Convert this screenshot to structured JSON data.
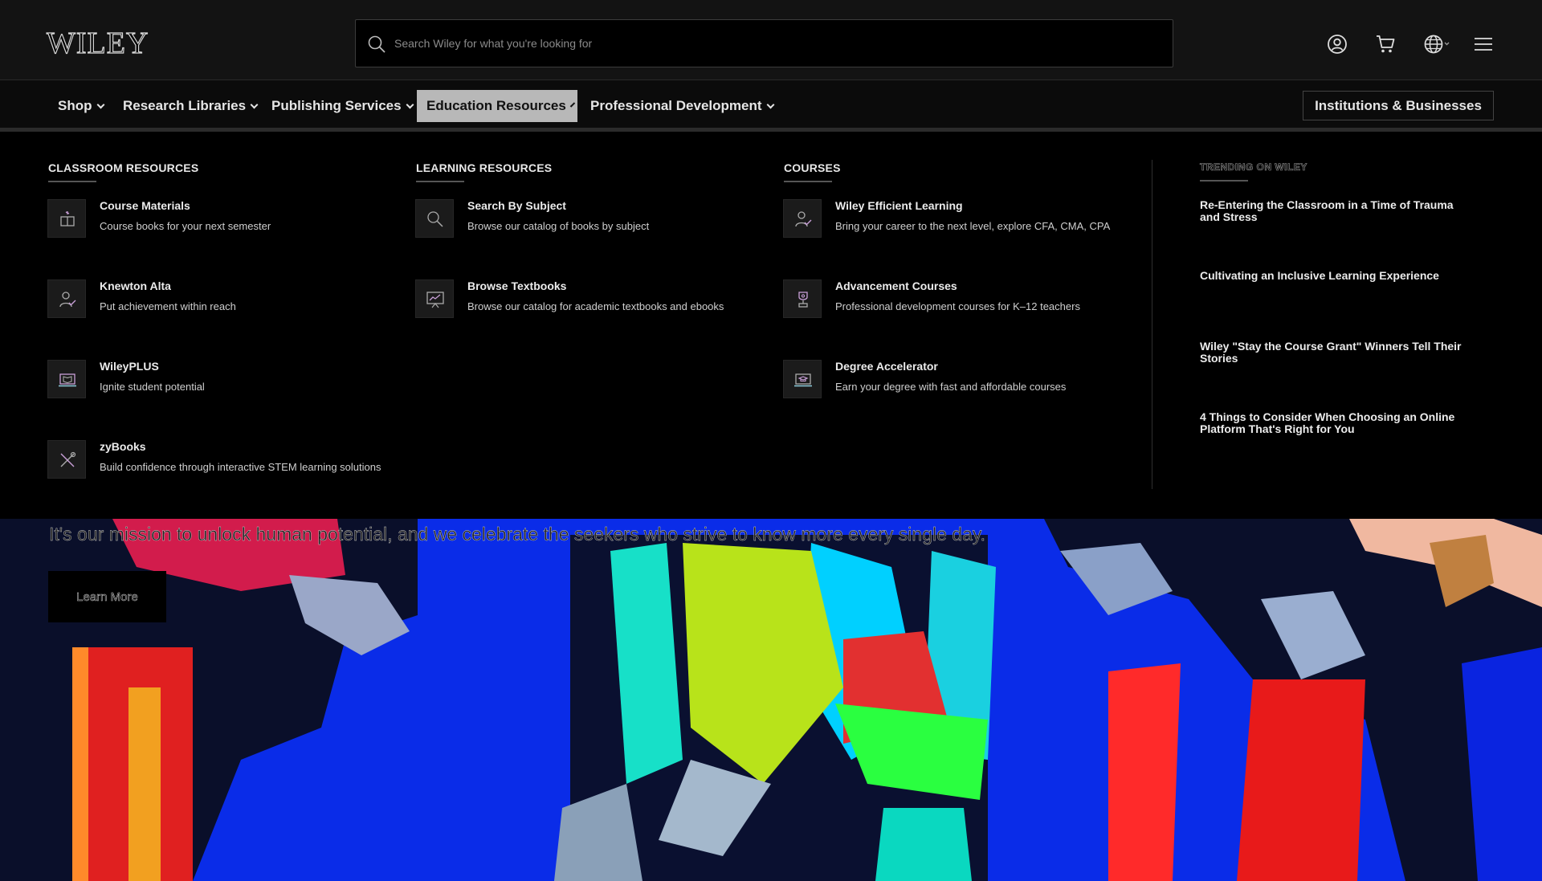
{
  "brand": {
    "logo_text": "WILEY"
  },
  "search": {
    "placeholder": "Search Wiley for what you're looking for"
  },
  "header_icons": [
    "account-icon",
    "cart-icon",
    "globe-icon",
    "menu-icon"
  ],
  "nav": {
    "items": [
      {
        "label": "Shop"
      },
      {
        "label": "Research Libraries"
      },
      {
        "label": "Publishing Services"
      },
      {
        "label": "Education Resources",
        "active": true
      },
      {
        "label": "Professional Development"
      }
    ],
    "cta": "Institutions & Businesses"
  },
  "mega": {
    "classroom": {
      "heading": "CLASSROOM RESOURCES",
      "items": [
        {
          "title": "Course Materials",
          "desc": "Course books for your next semester",
          "icon": "course-materials-icon"
        },
        {
          "title": "Knewton Alta",
          "desc": "Put achievement within reach",
          "icon": "person-check-icon"
        },
        {
          "title": "WileyPLUS",
          "desc": "Ignite student potential",
          "icon": "laptop-book-icon"
        },
        {
          "title": "zyBooks",
          "desc": "Build confidence through interactive STEM learning solutions",
          "icon": "tools-icon"
        }
      ]
    },
    "learning": {
      "heading": "LEARNING RESOURCES",
      "items": [
        {
          "title": "Search By Subject",
          "desc": "Browse our catalog of books by subject",
          "icon": "search-icon"
        },
        {
          "title": "Browse Textbooks",
          "desc": "Browse our catalog for academic textbooks and ebooks",
          "icon": "presentation-chart-icon"
        }
      ]
    },
    "courses": {
      "heading": "COURSES",
      "items": [
        {
          "title": "Wiley Efficient Learning",
          "desc": "Bring your career to the next level, explore CFA, CMA, CPA",
          "icon": "person-check-icon"
        },
        {
          "title": "Advancement Courses",
          "desc": "Professional development courses for K–12 teachers",
          "icon": "trophy-icon"
        },
        {
          "title": "Degree Accelerator",
          "desc": "Earn your degree with fast and affordable courses",
          "icon": "laptop-graduation-icon"
        }
      ]
    },
    "trending": {
      "heading": "TRENDING ON WILEY",
      "items": [
        "Re-Entering the Classroom in a Time of Trauma and Stress",
        "Cultivating an Inclusive Learning Experience",
        "Wiley \"Stay the Course Grant\" Winners Tell Their Stories",
        "4 Things to Consider When Choosing an Online Platform That's Right for You"
      ]
    }
  },
  "hero": {
    "text": "It's our mission to unlock human potential, and we celebrate the seekers who strive to know more every single day.",
    "button": "Learn More"
  }
}
